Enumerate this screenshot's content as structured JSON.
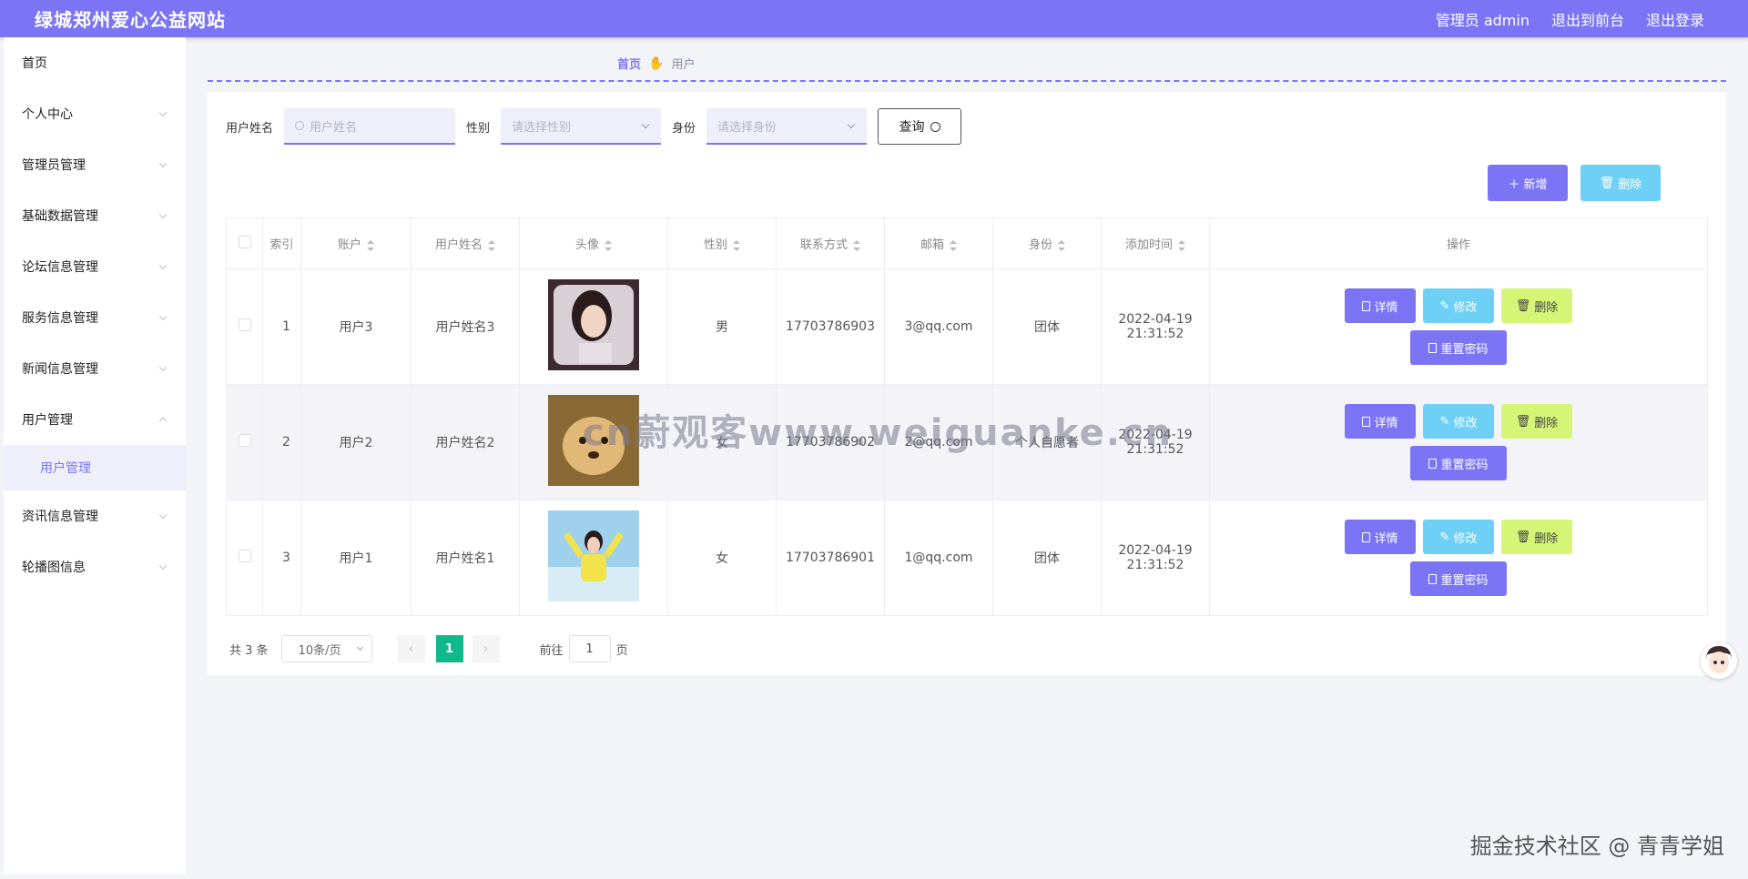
{
  "header": {
    "title": "绿城郑州爱心公益网站",
    "admin_label": "管理员 admin",
    "front_link": "退出到前台",
    "logout_link": "退出登录"
  },
  "sidebar": {
    "items": [
      {
        "label": "首页"
      },
      {
        "label": "个人中心"
      },
      {
        "label": "管理员管理"
      },
      {
        "label": "基础数据管理"
      },
      {
        "label": "论坛信息管理"
      },
      {
        "label": "服务信息管理"
      },
      {
        "label": "新闻信息管理"
      },
      {
        "label": "用户管理"
      },
      {
        "label": "用户管理"
      },
      {
        "label": "资讯信息管理"
      },
      {
        "label": "轮播图信息"
      }
    ]
  },
  "breadcrumb": {
    "home": "首页",
    "current": "用户"
  },
  "filters": {
    "name_label": "用户姓名",
    "name_placeholder": "用户姓名",
    "gender_label": "性别",
    "gender_placeholder": "请选择性别",
    "identity_label": "身份",
    "identity_placeholder": "请选择身份",
    "query_label": "查询"
  },
  "toolbar": {
    "add_label": "新增",
    "delete_label": "删除"
  },
  "table": {
    "headers": [
      "索引",
      "账户",
      "用户姓名",
      "头像",
      "性别",
      "联系方式",
      "邮箱",
      "身份",
      "添加时间",
      "操作"
    ],
    "rows": [
      {
        "index": "1",
        "account": "用户3",
        "name": "用户姓名3",
        "gender": "男",
        "phone": "17703786903",
        "email": "3@qq.com",
        "identity": "团体",
        "time": "2022-04-19 21:31:52"
      },
      {
        "index": "2",
        "account": "用户2",
        "name": "用户姓名2",
        "gender": "女",
        "phone": "17703786902",
        "email": "2@qq.com",
        "identity": "个人自愿者",
        "time": "2022-04-19 21:31:52"
      },
      {
        "index": "3",
        "account": "用户1",
        "name": "用户姓名1",
        "gender": "女",
        "phone": "17703786901",
        "email": "1@qq.com",
        "identity": "团体",
        "time": "2022-04-19 21:31:52"
      }
    ],
    "op_detail": "详情",
    "op_edit": "修改",
    "op_delete": "删除",
    "op_reset": "重置密码"
  },
  "pagination": {
    "total": "共 3 条",
    "page_size": "10条/页",
    "current_page": "1",
    "goto_prefix": "前往",
    "goto_value": "1",
    "goto_suffix": "页"
  },
  "watermark": "cn蔚观客www.weiguanke.cn",
  "credit": "掘金技术社区 @ 青青学姐",
  "colors": {
    "primary": "#7b75f5",
    "cyan": "#6ed0f5",
    "lime": "#d6f576",
    "page_active": "#10b98a"
  }
}
